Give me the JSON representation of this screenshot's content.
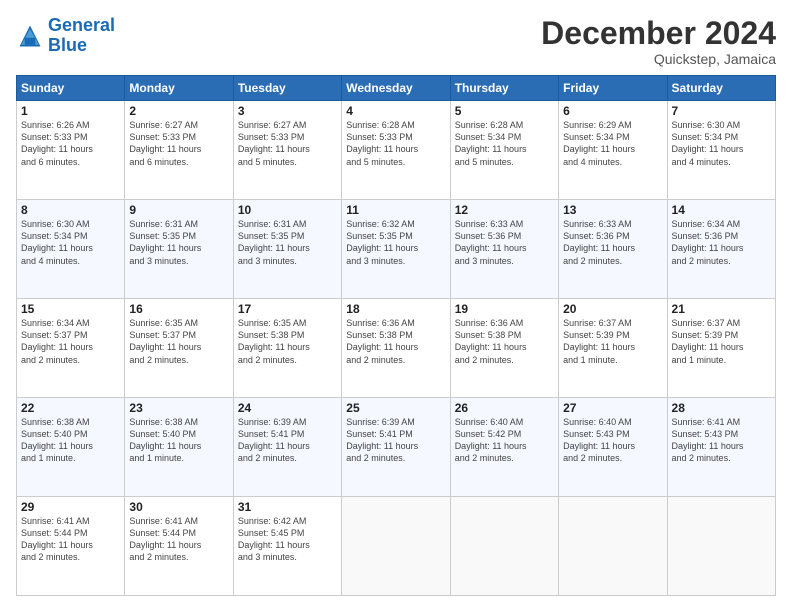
{
  "logo": {
    "line1": "General",
    "line2": "Blue"
  },
  "title": "December 2024",
  "subtitle": "Quickstep, Jamaica",
  "header_days": [
    "Sunday",
    "Monday",
    "Tuesday",
    "Wednesday",
    "Thursday",
    "Friday",
    "Saturday"
  ],
  "weeks": [
    [
      {
        "day": "1",
        "info": "Sunrise: 6:26 AM\nSunset: 5:33 PM\nDaylight: 11 hours\nand 6 minutes."
      },
      {
        "day": "2",
        "info": "Sunrise: 6:27 AM\nSunset: 5:33 PM\nDaylight: 11 hours\nand 6 minutes."
      },
      {
        "day": "3",
        "info": "Sunrise: 6:27 AM\nSunset: 5:33 PM\nDaylight: 11 hours\nand 5 minutes."
      },
      {
        "day": "4",
        "info": "Sunrise: 6:28 AM\nSunset: 5:33 PM\nDaylight: 11 hours\nand 5 minutes."
      },
      {
        "day": "5",
        "info": "Sunrise: 6:28 AM\nSunset: 5:34 PM\nDaylight: 11 hours\nand 5 minutes."
      },
      {
        "day": "6",
        "info": "Sunrise: 6:29 AM\nSunset: 5:34 PM\nDaylight: 11 hours\nand 4 minutes."
      },
      {
        "day": "7",
        "info": "Sunrise: 6:30 AM\nSunset: 5:34 PM\nDaylight: 11 hours\nand 4 minutes."
      }
    ],
    [
      {
        "day": "8",
        "info": "Sunrise: 6:30 AM\nSunset: 5:34 PM\nDaylight: 11 hours\nand 4 minutes."
      },
      {
        "day": "9",
        "info": "Sunrise: 6:31 AM\nSunset: 5:35 PM\nDaylight: 11 hours\nand 3 minutes."
      },
      {
        "day": "10",
        "info": "Sunrise: 6:31 AM\nSunset: 5:35 PM\nDaylight: 11 hours\nand 3 minutes."
      },
      {
        "day": "11",
        "info": "Sunrise: 6:32 AM\nSunset: 5:35 PM\nDaylight: 11 hours\nand 3 minutes."
      },
      {
        "day": "12",
        "info": "Sunrise: 6:33 AM\nSunset: 5:36 PM\nDaylight: 11 hours\nand 3 minutes."
      },
      {
        "day": "13",
        "info": "Sunrise: 6:33 AM\nSunset: 5:36 PM\nDaylight: 11 hours\nand 2 minutes."
      },
      {
        "day": "14",
        "info": "Sunrise: 6:34 AM\nSunset: 5:36 PM\nDaylight: 11 hours\nand 2 minutes."
      }
    ],
    [
      {
        "day": "15",
        "info": "Sunrise: 6:34 AM\nSunset: 5:37 PM\nDaylight: 11 hours\nand 2 minutes."
      },
      {
        "day": "16",
        "info": "Sunrise: 6:35 AM\nSunset: 5:37 PM\nDaylight: 11 hours\nand 2 minutes."
      },
      {
        "day": "17",
        "info": "Sunrise: 6:35 AM\nSunset: 5:38 PM\nDaylight: 11 hours\nand 2 minutes."
      },
      {
        "day": "18",
        "info": "Sunrise: 6:36 AM\nSunset: 5:38 PM\nDaylight: 11 hours\nand 2 minutes."
      },
      {
        "day": "19",
        "info": "Sunrise: 6:36 AM\nSunset: 5:38 PM\nDaylight: 11 hours\nand 2 minutes."
      },
      {
        "day": "20",
        "info": "Sunrise: 6:37 AM\nSunset: 5:39 PM\nDaylight: 11 hours\nand 1 minute."
      },
      {
        "day": "21",
        "info": "Sunrise: 6:37 AM\nSunset: 5:39 PM\nDaylight: 11 hours\nand 1 minute."
      }
    ],
    [
      {
        "day": "22",
        "info": "Sunrise: 6:38 AM\nSunset: 5:40 PM\nDaylight: 11 hours\nand 1 minute."
      },
      {
        "day": "23",
        "info": "Sunrise: 6:38 AM\nSunset: 5:40 PM\nDaylight: 11 hours\nand 1 minute."
      },
      {
        "day": "24",
        "info": "Sunrise: 6:39 AM\nSunset: 5:41 PM\nDaylight: 11 hours\nand 2 minutes."
      },
      {
        "day": "25",
        "info": "Sunrise: 6:39 AM\nSunset: 5:41 PM\nDaylight: 11 hours\nand 2 minutes."
      },
      {
        "day": "26",
        "info": "Sunrise: 6:40 AM\nSunset: 5:42 PM\nDaylight: 11 hours\nand 2 minutes."
      },
      {
        "day": "27",
        "info": "Sunrise: 6:40 AM\nSunset: 5:43 PM\nDaylight: 11 hours\nand 2 minutes."
      },
      {
        "day": "28",
        "info": "Sunrise: 6:41 AM\nSunset: 5:43 PM\nDaylight: 11 hours\nand 2 minutes."
      }
    ],
    [
      {
        "day": "29",
        "info": "Sunrise: 6:41 AM\nSunset: 5:44 PM\nDaylight: 11 hours\nand 2 minutes."
      },
      {
        "day": "30",
        "info": "Sunrise: 6:41 AM\nSunset: 5:44 PM\nDaylight: 11 hours\nand 2 minutes."
      },
      {
        "day": "31",
        "info": "Sunrise: 6:42 AM\nSunset: 5:45 PM\nDaylight: 11 hours\nand 3 minutes."
      },
      {
        "day": "",
        "info": ""
      },
      {
        "day": "",
        "info": ""
      },
      {
        "day": "",
        "info": ""
      },
      {
        "day": "",
        "info": ""
      }
    ]
  ]
}
